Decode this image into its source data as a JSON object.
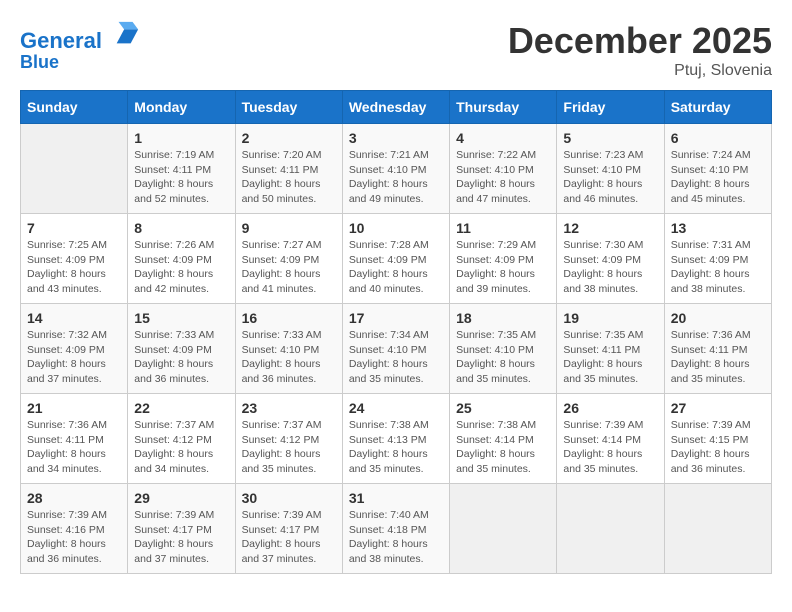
{
  "header": {
    "logo_line1": "General",
    "logo_line2": "Blue",
    "month_year": "December 2025",
    "location": "Ptuj, Slovenia"
  },
  "days_of_week": [
    "Sunday",
    "Monday",
    "Tuesday",
    "Wednesday",
    "Thursday",
    "Friday",
    "Saturday"
  ],
  "weeks": [
    [
      {
        "day": "",
        "empty": true
      },
      {
        "day": "1",
        "sunrise": "Sunrise: 7:19 AM",
        "sunset": "Sunset: 4:11 PM",
        "daylight": "Daylight: 8 hours and 52 minutes."
      },
      {
        "day": "2",
        "sunrise": "Sunrise: 7:20 AM",
        "sunset": "Sunset: 4:11 PM",
        "daylight": "Daylight: 8 hours and 50 minutes."
      },
      {
        "day": "3",
        "sunrise": "Sunrise: 7:21 AM",
        "sunset": "Sunset: 4:10 PM",
        "daylight": "Daylight: 8 hours and 49 minutes."
      },
      {
        "day": "4",
        "sunrise": "Sunrise: 7:22 AM",
        "sunset": "Sunset: 4:10 PM",
        "daylight": "Daylight: 8 hours and 47 minutes."
      },
      {
        "day": "5",
        "sunrise": "Sunrise: 7:23 AM",
        "sunset": "Sunset: 4:10 PM",
        "daylight": "Daylight: 8 hours and 46 minutes."
      },
      {
        "day": "6",
        "sunrise": "Sunrise: 7:24 AM",
        "sunset": "Sunset: 4:10 PM",
        "daylight": "Daylight: 8 hours and 45 minutes."
      }
    ],
    [
      {
        "day": "7",
        "sunrise": "Sunrise: 7:25 AM",
        "sunset": "Sunset: 4:09 PM",
        "daylight": "Daylight: 8 hours and 43 minutes."
      },
      {
        "day": "8",
        "sunrise": "Sunrise: 7:26 AM",
        "sunset": "Sunset: 4:09 PM",
        "daylight": "Daylight: 8 hours and 42 minutes."
      },
      {
        "day": "9",
        "sunrise": "Sunrise: 7:27 AM",
        "sunset": "Sunset: 4:09 PM",
        "daylight": "Daylight: 8 hours and 41 minutes."
      },
      {
        "day": "10",
        "sunrise": "Sunrise: 7:28 AM",
        "sunset": "Sunset: 4:09 PM",
        "daylight": "Daylight: 8 hours and 40 minutes."
      },
      {
        "day": "11",
        "sunrise": "Sunrise: 7:29 AM",
        "sunset": "Sunset: 4:09 PM",
        "daylight": "Daylight: 8 hours and 39 minutes."
      },
      {
        "day": "12",
        "sunrise": "Sunrise: 7:30 AM",
        "sunset": "Sunset: 4:09 PM",
        "daylight": "Daylight: 8 hours and 38 minutes."
      },
      {
        "day": "13",
        "sunrise": "Sunrise: 7:31 AM",
        "sunset": "Sunset: 4:09 PM",
        "daylight": "Daylight: 8 hours and 38 minutes."
      }
    ],
    [
      {
        "day": "14",
        "sunrise": "Sunrise: 7:32 AM",
        "sunset": "Sunset: 4:09 PM",
        "daylight": "Daylight: 8 hours and 37 minutes."
      },
      {
        "day": "15",
        "sunrise": "Sunrise: 7:33 AM",
        "sunset": "Sunset: 4:09 PM",
        "daylight": "Daylight: 8 hours and 36 minutes."
      },
      {
        "day": "16",
        "sunrise": "Sunrise: 7:33 AM",
        "sunset": "Sunset: 4:10 PM",
        "daylight": "Daylight: 8 hours and 36 minutes."
      },
      {
        "day": "17",
        "sunrise": "Sunrise: 7:34 AM",
        "sunset": "Sunset: 4:10 PM",
        "daylight": "Daylight: 8 hours and 35 minutes."
      },
      {
        "day": "18",
        "sunrise": "Sunrise: 7:35 AM",
        "sunset": "Sunset: 4:10 PM",
        "daylight": "Daylight: 8 hours and 35 minutes."
      },
      {
        "day": "19",
        "sunrise": "Sunrise: 7:35 AM",
        "sunset": "Sunset: 4:11 PM",
        "daylight": "Daylight: 8 hours and 35 minutes."
      },
      {
        "day": "20",
        "sunrise": "Sunrise: 7:36 AM",
        "sunset": "Sunset: 4:11 PM",
        "daylight": "Daylight: 8 hours and 35 minutes."
      }
    ],
    [
      {
        "day": "21",
        "sunrise": "Sunrise: 7:36 AM",
        "sunset": "Sunset: 4:11 PM",
        "daylight": "Daylight: 8 hours and 34 minutes."
      },
      {
        "day": "22",
        "sunrise": "Sunrise: 7:37 AM",
        "sunset": "Sunset: 4:12 PM",
        "daylight": "Daylight: 8 hours and 34 minutes."
      },
      {
        "day": "23",
        "sunrise": "Sunrise: 7:37 AM",
        "sunset": "Sunset: 4:12 PM",
        "daylight": "Daylight: 8 hours and 35 minutes."
      },
      {
        "day": "24",
        "sunrise": "Sunrise: 7:38 AM",
        "sunset": "Sunset: 4:13 PM",
        "daylight": "Daylight: 8 hours and 35 minutes."
      },
      {
        "day": "25",
        "sunrise": "Sunrise: 7:38 AM",
        "sunset": "Sunset: 4:14 PM",
        "daylight": "Daylight: 8 hours and 35 minutes."
      },
      {
        "day": "26",
        "sunrise": "Sunrise: 7:39 AM",
        "sunset": "Sunset: 4:14 PM",
        "daylight": "Daylight: 8 hours and 35 minutes."
      },
      {
        "day": "27",
        "sunrise": "Sunrise: 7:39 AM",
        "sunset": "Sunset: 4:15 PM",
        "daylight": "Daylight: 8 hours and 36 minutes."
      }
    ],
    [
      {
        "day": "28",
        "sunrise": "Sunrise: 7:39 AM",
        "sunset": "Sunset: 4:16 PM",
        "daylight": "Daylight: 8 hours and 36 minutes."
      },
      {
        "day": "29",
        "sunrise": "Sunrise: 7:39 AM",
        "sunset": "Sunset: 4:17 PM",
        "daylight": "Daylight: 8 hours and 37 minutes."
      },
      {
        "day": "30",
        "sunrise": "Sunrise: 7:39 AM",
        "sunset": "Sunset: 4:17 PM",
        "daylight": "Daylight: 8 hours and 37 minutes."
      },
      {
        "day": "31",
        "sunrise": "Sunrise: 7:40 AM",
        "sunset": "Sunset: 4:18 PM",
        "daylight": "Daylight: 8 hours and 38 minutes."
      },
      {
        "day": "",
        "empty": true
      },
      {
        "day": "",
        "empty": true
      },
      {
        "day": "",
        "empty": true
      }
    ]
  ]
}
